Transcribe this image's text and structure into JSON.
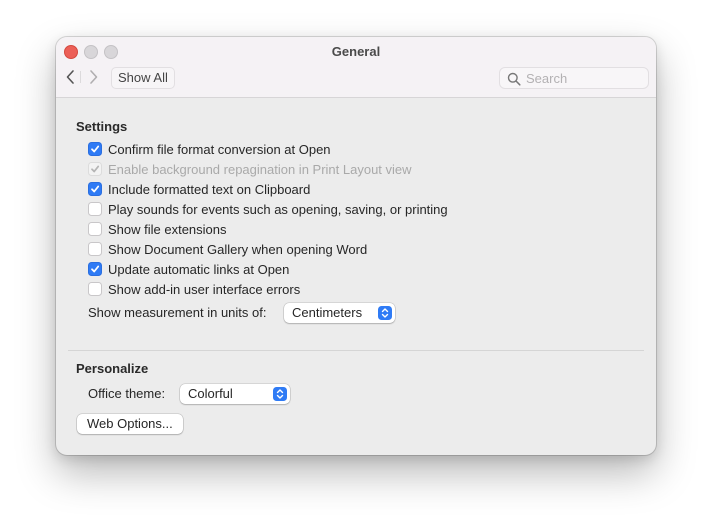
{
  "window": {
    "title": "General"
  },
  "toolbar": {
    "show_all_label": "Show All",
    "search_placeholder": "Search",
    "search_value": ""
  },
  "settings": {
    "title": "Settings",
    "options": [
      {
        "label": "Confirm file format conversion at Open",
        "checked": true,
        "enabled": true
      },
      {
        "label": "Enable background repagination in Print Layout view",
        "checked": true,
        "enabled": false
      },
      {
        "label": "Include formatted text on Clipboard",
        "checked": true,
        "enabled": true
      },
      {
        "label": "Play sounds for events such as opening, saving, or printing",
        "checked": false,
        "enabled": true
      },
      {
        "label": "Show file extensions",
        "checked": false,
        "enabled": true
      },
      {
        "label": "Show Document Gallery when opening Word",
        "checked": false,
        "enabled": true
      },
      {
        "label": "Update automatic links at Open",
        "checked": true,
        "enabled": true
      },
      {
        "label": "Show add-in user interface errors",
        "checked": false,
        "enabled": true
      }
    ],
    "measurement_label": "Show measurement in units of:",
    "measurement_value": "Centimeters"
  },
  "personalize": {
    "title": "Personalize",
    "theme_label": "Office theme:",
    "theme_value": "Colorful",
    "web_options_label": "Web Options..."
  },
  "colors": {
    "accent": "#2f7bf5",
    "close_button": "#ec5f57",
    "inactive_button": "#d8d6d9"
  }
}
